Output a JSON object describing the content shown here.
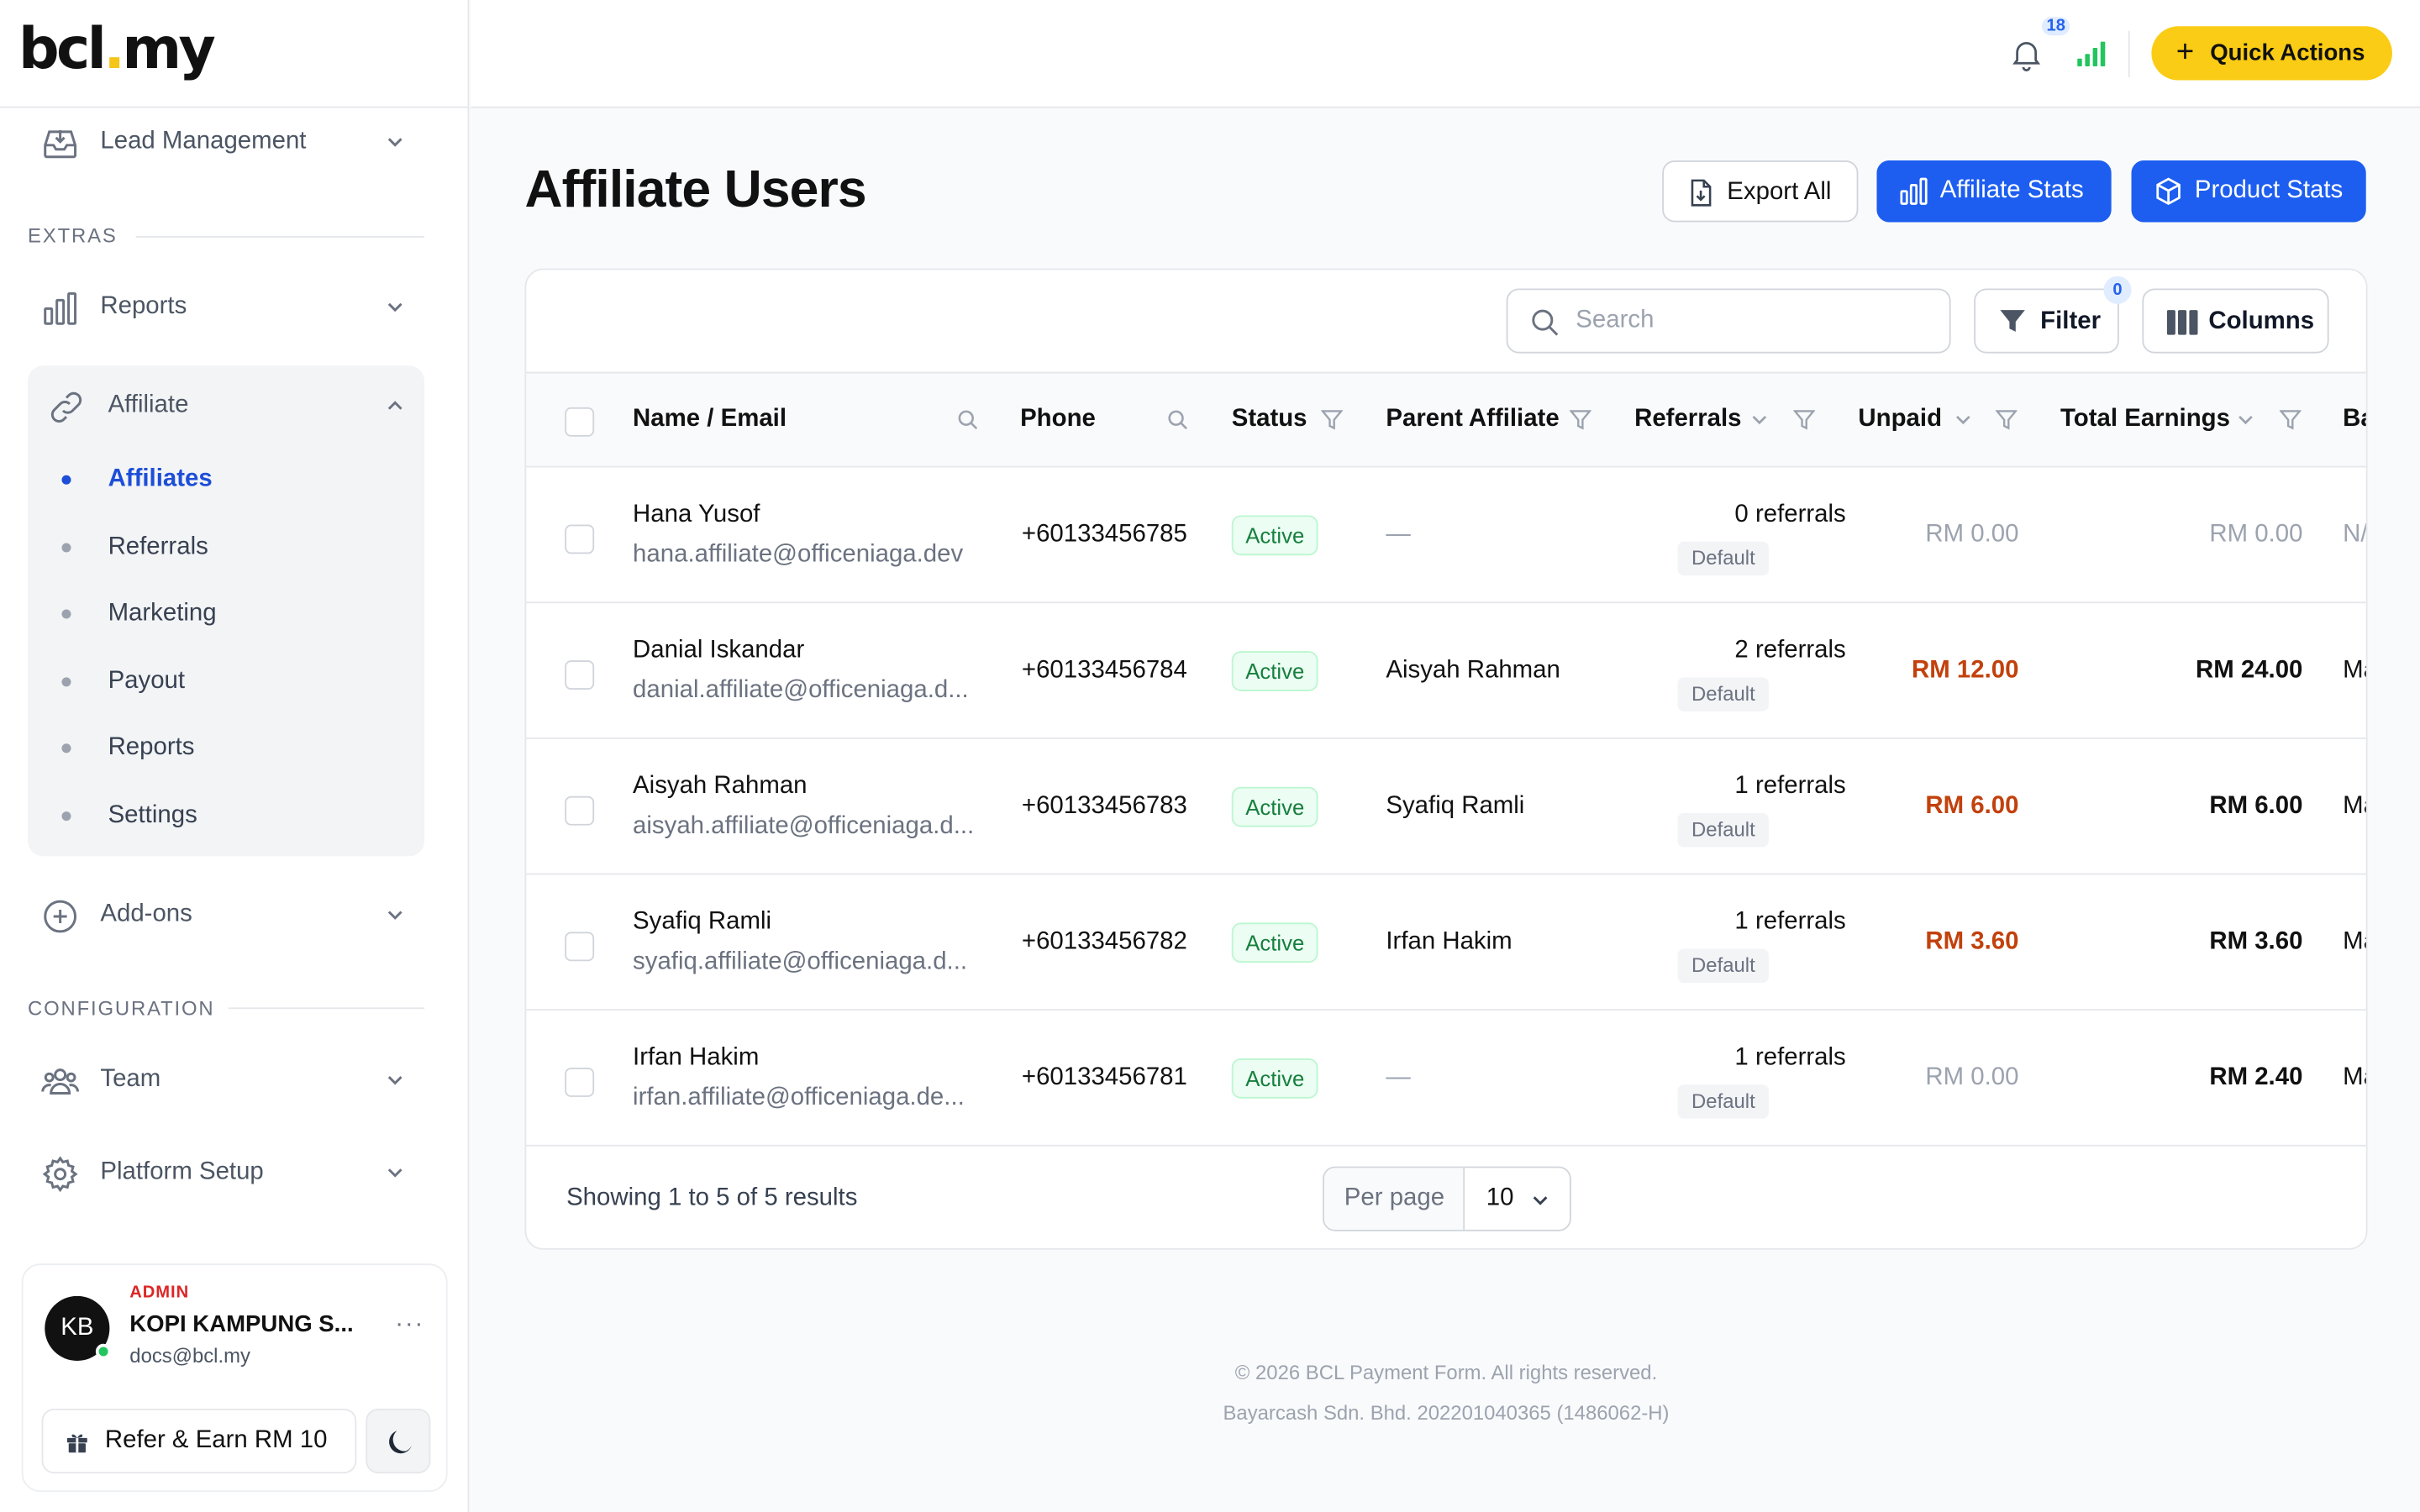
{
  "brand": {
    "logo_part1": "bcl",
    "logo_dot": ".",
    "logo_part2": "my",
    "accent": "#f5c518"
  },
  "sidebar": {
    "lead_management": "Lead Management",
    "extras_label": "EXTRAS",
    "reports": "Reports",
    "affiliate": "Affiliate",
    "affiliate_items": [
      {
        "label": "Affiliates",
        "active": true
      },
      {
        "label": "Referrals"
      },
      {
        "label": "Marketing"
      },
      {
        "label": "Payout"
      },
      {
        "label": "Reports"
      },
      {
        "label": "Settings"
      }
    ],
    "addons": "Add-ons",
    "config_label": "CONFIGURATION",
    "team": "Team",
    "platform_setup": "Platform Setup",
    "user": {
      "role": "ADMIN",
      "initials": "KB",
      "org": "KOPI KAMPUNG S...",
      "email": "docs@bcl.my",
      "more": "···"
    },
    "refer_label": "Refer & Earn RM 10"
  },
  "topbar": {
    "notifications_count": "18",
    "quick_actions": "Quick Actions",
    "quick_actions_plus": "+",
    "quick_actions_color": "#facc15"
  },
  "page": {
    "title": "Affiliate Users",
    "export_all": "Export All",
    "affiliate_stats": "Affiliate Stats",
    "product_stats": "Product Stats",
    "primary_color": "#1d5ef0"
  },
  "toolbar": {
    "search_placeholder": "Search",
    "filter_label": "Filter",
    "filter_count": "0",
    "columns_label": "Columns"
  },
  "table": {
    "columns": [
      "Name / Email",
      "Phone",
      "Status",
      "Parent Affiliate",
      "Referrals",
      "Unpaid",
      "Total Earnings",
      "Ba"
    ],
    "rows": [
      {
        "name": "Hana Yusof",
        "email": "hana.affiliate@officeniaga.dev",
        "phone": "+60133456785",
        "status": "Active",
        "parent": "—",
        "referrals": "0 referrals",
        "tier": "Default",
        "unpaid": "RM 0.00",
        "total": "RM 0.00",
        "ba": "N/"
      },
      {
        "name": "Danial Iskandar",
        "email": "danial.affiliate@officeniaga.d...",
        "phone": "+60133456784",
        "status": "Active",
        "parent": "Aisyah Rahman",
        "referrals": "2 referrals",
        "tier": "Default",
        "unpaid": "RM 12.00",
        "total": "RM 24.00",
        "ba": "Ma"
      },
      {
        "name": "Aisyah Rahman",
        "email": "aisyah.affiliate@officeniaga.d...",
        "phone": "+60133456783",
        "status": "Active",
        "parent": "Syafiq Ramli",
        "referrals": "1 referrals",
        "tier": "Default",
        "unpaid": "RM 6.00",
        "total": "RM 6.00",
        "ba": "Ma"
      },
      {
        "name": "Syafiq Ramli",
        "email": "syafiq.affiliate@officeniaga.d...",
        "phone": "+60133456782",
        "status": "Active",
        "parent": "Irfan Hakim",
        "referrals": "1 referrals",
        "tier": "Default",
        "unpaid": "RM 3.60",
        "total": "RM 3.60",
        "ba": "Ma"
      },
      {
        "name": "Irfan Hakim",
        "email": "irfan.affiliate@officeniaga.de...",
        "phone": "+60133456781",
        "status": "Active",
        "parent": "—",
        "referrals": "1 referrals",
        "tier": "Default",
        "unpaid": "RM 0.00",
        "total": "RM 2.40",
        "ba": "Ma"
      }
    ],
    "showing": "Showing 1 to 5 of 5 results",
    "per_page_label": "Per page",
    "per_page_value": "10"
  },
  "footer": {
    "copyright": "© 2026 BCL Payment Form. All rights reserved.",
    "company": "Bayarcash Sdn. Bhd. 202201040365 (1486062-H)"
  }
}
